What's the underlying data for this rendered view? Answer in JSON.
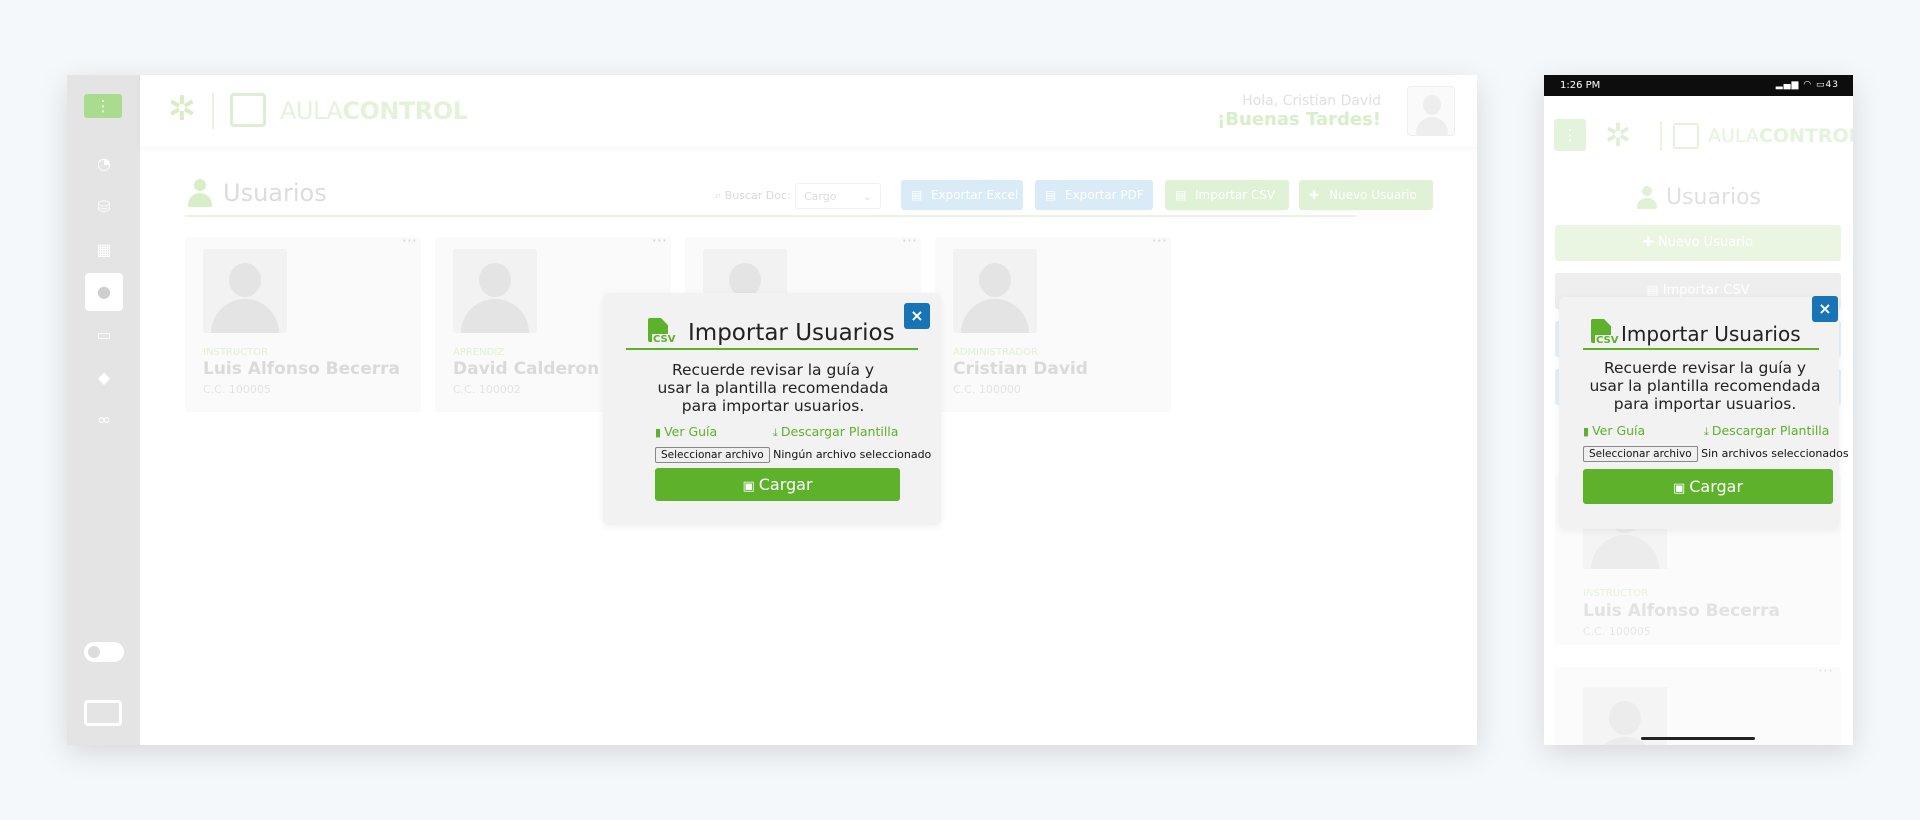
{
  "app": {
    "brand_light": "AULA",
    "brand_bold": "CONTROL"
  },
  "header": {
    "greeting": "Hola, Cristian David",
    "salutation": "¡Buenas Tardes!"
  },
  "sidebar": {
    "items": [
      {
        "icon": "dashboard-icon"
      },
      {
        "icon": "database-icon"
      },
      {
        "icon": "table-icon"
      },
      {
        "icon": "user-icon",
        "active": true
      },
      {
        "icon": "monitor-icon"
      },
      {
        "icon": "tag-icon"
      },
      {
        "icon": "binoculars-icon"
      }
    ]
  },
  "page": {
    "title": "Usuarios",
    "search_label": "Buscar Doc:",
    "cargo_select": "Cargo",
    "buttons": {
      "export_excel": "Exportar Excel",
      "export_pdf": "Exportar PDF",
      "import_csv": "Importar CSV",
      "new_user": "Nuevo Usuario"
    }
  },
  "users": [
    {
      "role": "INSTRUCTOR",
      "name": "Luis Alfonso Becerra",
      "cc": "C.C. 100005"
    },
    {
      "role": "APRENDIZ",
      "name": "David Calderon",
      "cc": "C.C. 100002"
    },
    {
      "role": "",
      "name": "",
      "cc": ""
    },
    {
      "role": "ADMINISTRADOR",
      "name": "Cristian David",
      "cc": "C.C. 100000"
    }
  ],
  "modal": {
    "title": "Importar Usuarios",
    "icon_text": "CSV",
    "message": "Recuerde revisar la guía y usar la plantilla recomendada para importar usuarios.",
    "guide_link": "Ver Guía",
    "template_link": "Descargar Plantilla",
    "file_button": "Seleccionar archivo",
    "file_status_desktop": "Ningún archivo seleccionado",
    "file_status_mobile": "Sin archivos seleccionados",
    "submit": "Cargar",
    "close": "×"
  },
  "mobile": {
    "status_time": "1:26 PM",
    "battery": "43",
    "buttons": {
      "new_user": "Nuevo Usuario",
      "import_csv": "Importar CSV"
    },
    "card": {
      "role": "INSTRUCTOR",
      "name": "Luis Alfonso Becerra",
      "cc": "C.C. 100005"
    }
  },
  "colors": {
    "accent_green": "#5db12b",
    "close_blue": "#1874b4",
    "modal_bg": "#f2f2f2"
  }
}
